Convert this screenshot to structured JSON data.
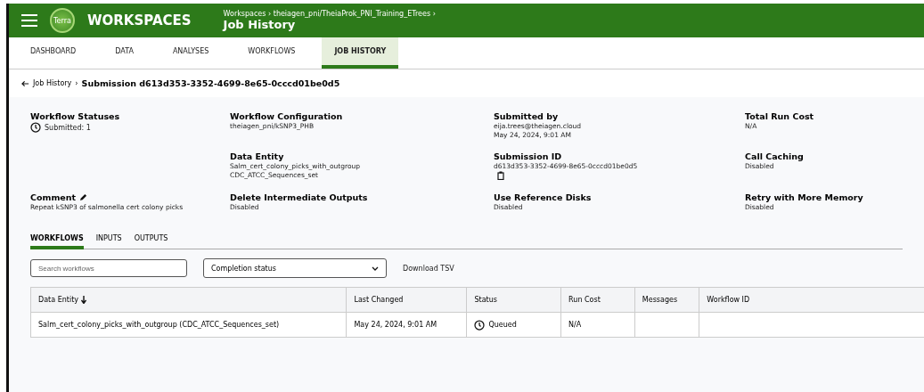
{
  "header": {
    "logo": "Terra",
    "title": "WORKSPACES",
    "breadcrumb": "Workspaces › theiagen_pni/TheiaProk_PNI_Training_ETrees ›",
    "page": "Job History"
  },
  "tabs": [
    {
      "label": "DASHBOARD",
      "selected": false
    },
    {
      "label": "DATA",
      "selected": false
    },
    {
      "label": "ANALYSES",
      "selected": false
    },
    {
      "label": "WORKFLOWS",
      "selected": false
    },
    {
      "label": "JOB HISTORY",
      "selected": true
    }
  ],
  "breadcrumb": {
    "link": "Job History",
    "separator": "›",
    "current": "Submission d613d353-3352-4699-8e65-0cccd01be0d5"
  },
  "details": [
    {
      "label": "Workflow Statuses",
      "kind": "status",
      "lines": [
        "Submitted: 1"
      ]
    },
    {
      "label": "Workflow Configuration",
      "kind": "text",
      "lines": [
        "theiagen_pni/kSNP3_PHB"
      ]
    },
    {
      "label": "Submitted by",
      "kind": "text",
      "lines": [
        "eija.trees@theiagen.cloud",
        "May 24, 2024, 9:01 AM"
      ]
    },
    {
      "label": "Total Run Cost",
      "kind": "text",
      "lines": [
        "N/A"
      ]
    },
    {
      "kind": "empty"
    },
    {
      "label": "Data Entity",
      "kind": "text",
      "lines": [
        "Salm_cert_colony_picks_with_outgroup",
        "CDC_ATCC_Sequences_set"
      ]
    },
    {
      "label": "Submission ID",
      "kind": "copy",
      "lines": [
        "d613d353-3352-4699-8e65-0cccd01be0d5"
      ]
    },
    {
      "label": "Call Caching",
      "kind": "text",
      "lines": [
        "Disabled"
      ]
    },
    {
      "label": "Comment",
      "kind": "edit",
      "lines": [
        "Repeat kSNP3 of salmonella cert colony picks"
      ]
    },
    {
      "label": "Delete Intermediate Outputs",
      "kind": "text",
      "lines": [
        "Disabled"
      ]
    },
    {
      "label": "Use Reference Disks",
      "kind": "text",
      "lines": [
        "Disabled"
      ]
    },
    {
      "label": "Retry with More Memory",
      "kind": "text",
      "lines": [
        "Disabled"
      ]
    }
  ],
  "subtabs": [
    {
      "label": "WORKFLOWS",
      "selected": true
    },
    {
      "label": "INPUTS",
      "selected": false
    },
    {
      "label": "OUTPUTS",
      "selected": false
    }
  ],
  "search": {
    "placeholder": "Search workflows"
  },
  "filter": {
    "value": "Completion status"
  },
  "download": "Download TSV",
  "table": {
    "columns": [
      {
        "label": "Data Entity",
        "sorted": true
      },
      {
        "label": "Last Changed",
        "sorted": false
      },
      {
        "label": "Status",
        "sorted": false
      },
      {
        "label": "Run Cost",
        "sorted": false
      },
      {
        "label": "Messages",
        "sorted": false
      },
      {
        "label": "Workflow ID",
        "sorted": false
      }
    ],
    "rows": [
      {
        "cells": [
          "Salm_cert_colony_picks_with_outgroup (CDC_ATCC_Sequences_set)",
          "May 24, 2024, 9:01 AM",
          "Queued",
          "N/A",
          "",
          ""
        ]
      }
    ]
  }
}
